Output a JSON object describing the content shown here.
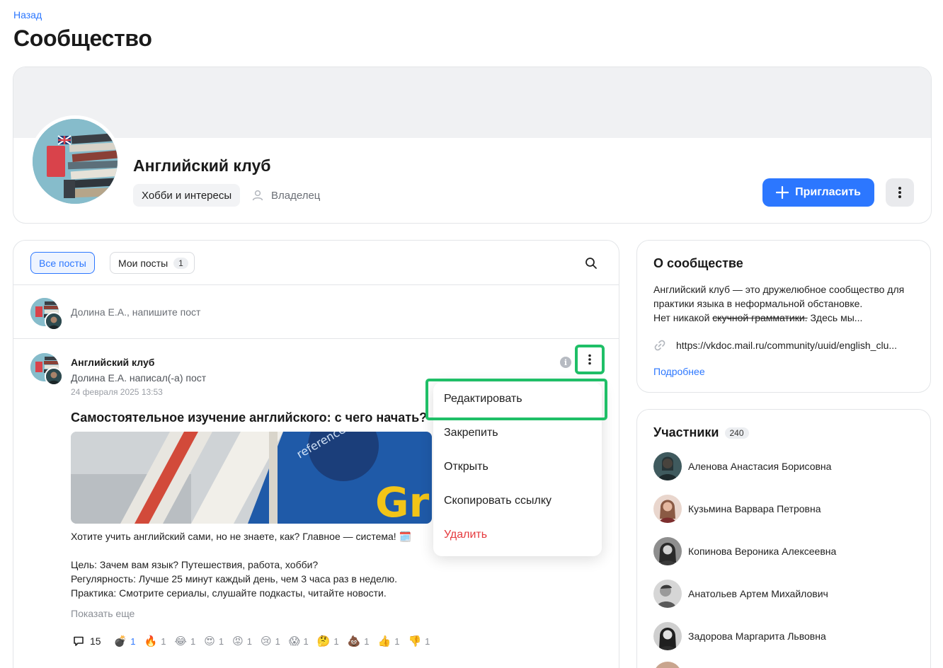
{
  "nav": {
    "back_label": "Назад"
  },
  "page": {
    "title": "Сообщество"
  },
  "community": {
    "name": "Английский клуб",
    "category": "Хобби и интересы",
    "role": "Владелец",
    "invite_label": "Пригласить",
    "avatar_icon": "books-stack-image"
  },
  "feed": {
    "tabs": [
      {
        "label": "Все посты",
        "active": true
      },
      {
        "label": "Мои посты",
        "count": "1",
        "active": false
      }
    ],
    "compose_placeholder": "Долина Е.А., напишите пост",
    "post": {
      "club": "Английский клуб",
      "author_line": "Долина Е.А. написал(-а) пост",
      "date": "24 февраля 2025 13:53",
      "title": "Самостоятельное изучение английского: с чего начать?",
      "image_caption_text": "reference pocket guide",
      "body": [
        "Хотите учить английский сами, но не знаете, как? Главное — система! 🗓️",
        "",
        "Цель: Зачем вам язык? Путешествия, работа, хобби?",
        "Регулярность: Лучше 25 минут каждый день, чем 3 часа раз в неделю.",
        "Практика: Смотрите сериалы, слушайте подкасты, читайте новости."
      ],
      "show_more": "Показать еще",
      "comments_count": "15",
      "reactions": [
        {
          "emoji": "💣",
          "count": "1",
          "active": true
        },
        {
          "emoji": "🔥",
          "count": "1"
        },
        {
          "emoji": "😂",
          "count": "1"
        },
        {
          "emoji": "😍",
          "count": "1"
        },
        {
          "emoji": "😡",
          "count": "1"
        },
        {
          "emoji": "😢",
          "count": "1"
        },
        {
          "emoji": "😱",
          "count": "1"
        },
        {
          "emoji": "🤔",
          "count": "1"
        },
        {
          "emoji": "💩",
          "count": "1"
        },
        {
          "emoji": "👍",
          "count": "1"
        },
        {
          "emoji": "👎",
          "count": "1"
        }
      ]
    },
    "context_menu": [
      {
        "label": "Редактировать",
        "highlighted": true
      },
      {
        "label": "Закрепить"
      },
      {
        "label": "Открыть"
      },
      {
        "label": "Скопировать ссылку"
      },
      {
        "label": "Удалить",
        "danger": true
      }
    ]
  },
  "about": {
    "title": "О сообществе",
    "text_1": "Английский клуб — это дружелюбное сообщество для практики языка в неформальной обстановке.",
    "text_2": "Нет никакой ",
    "text_strike": "скучной грамматики.",
    "text_3": " Здесь мы...",
    "link": "https://vkdoc.mail.ru/community/uuid/english_clu...",
    "more_label": "Подробнее"
  },
  "members": {
    "title": "Участники",
    "count": "240",
    "list": [
      {
        "name": "Аленова Анастасия Борисовна"
      },
      {
        "name": "Кузьмина Варвара Петровна"
      },
      {
        "name": "Копинова Вероника Алексеевна"
      },
      {
        "name": "Анатольев Артем Михайлович"
      },
      {
        "name": "Задорова Маргарита Львовна"
      }
    ]
  },
  "colors": {
    "accent": "#2c77ff",
    "highlight": "#1fbf67",
    "danger": "#e5393d"
  }
}
